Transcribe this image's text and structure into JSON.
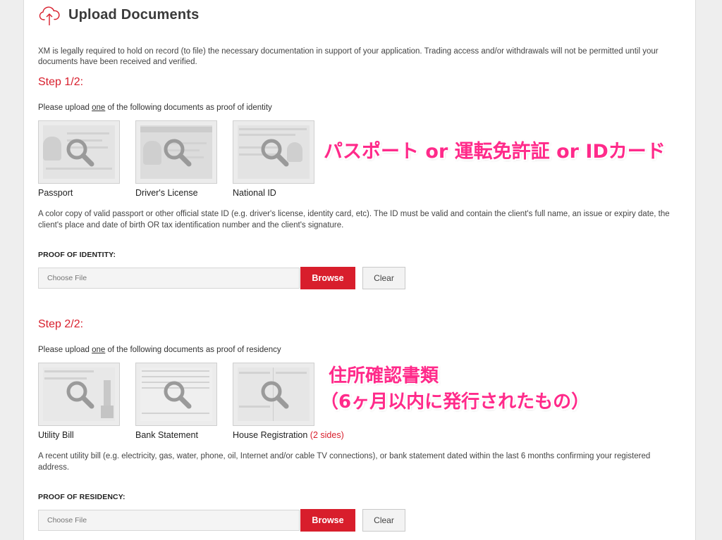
{
  "header": {
    "title": "Upload Documents",
    "icon": "cloud-upload-icon"
  },
  "intro_text": "XM is legally required to hold on record (to file) the necessary documentation in support of your application. Trading access and/or withdrawals will not be permitted until your documents have been received and verified.",
  "step1": {
    "title": "Step 1/2:",
    "instruction_prefix": "Please upload ",
    "instruction_emphasis": "one",
    "instruction_suffix": " of the following documents as proof of identity",
    "documents": [
      {
        "label": "Passport"
      },
      {
        "label": "Driver's License"
      },
      {
        "label": "National ID"
      }
    ],
    "description": "A color copy of valid passport or other official state ID (e.g. driver's license, identity card, etc). The ID must be valid and contain the client's full name, an issue or expiry date, the client's place and date of birth OR tax identification number and the client's signature.",
    "field_label": "PROOF OF IDENTITY:",
    "file_placeholder": "Choose File",
    "browse_label": "Browse",
    "clear_label": "Clear"
  },
  "step2": {
    "title": "Step 2/2:",
    "instruction_prefix": "Please upload ",
    "instruction_emphasis": "one",
    "instruction_suffix": " of the following documents as proof of residency",
    "documents": [
      {
        "label": "Utility Bill",
        "note": ""
      },
      {
        "label": "Bank Statement",
        "note": ""
      },
      {
        "label": "House Registration",
        "note": "(2 sides)"
      }
    ],
    "description": "A recent utility bill (e.g. electricity, gas, water, phone, oil, Internet and/or cable TV connections), or bank statement dated within the last 6 months confirming your registered address.",
    "field_label": "PROOF OF RESIDENCY:",
    "file_placeholder": "Choose File",
    "browse_label": "Browse",
    "clear_label": "Clear"
  },
  "annotations": {
    "identity_note": "パスポート or 運転免許証 or IDカード",
    "residency_note_line1": "住所確認書類",
    "residency_note_line2": "（6ヶ月以内に発行されたもの）"
  },
  "colors": {
    "accent": "#d81e2c",
    "annotation": "#ff2a8a"
  }
}
